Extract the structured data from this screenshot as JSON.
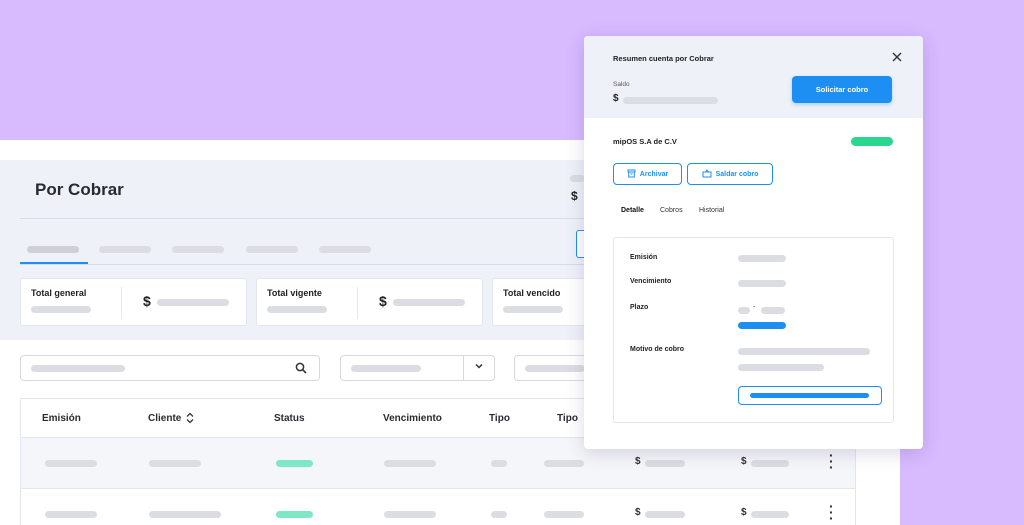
{
  "colors": {
    "accent": "#1e8ff2",
    "background_purple": "#d7baff",
    "status_green": "#2bd68f"
  },
  "main": {
    "title": "Por Cobrar",
    "summary_cards": [
      {
        "label": "Total general",
        "currency": "$"
      },
      {
        "label": "Total vigente",
        "currency": "$"
      },
      {
        "label": "Total vencido"
      }
    ],
    "search": {
      "icon": "search-icon"
    },
    "filter_select": {
      "icon": "chevron-down-icon"
    },
    "partial_currency": "$",
    "table": {
      "columns": [
        "Emisión",
        "Cliente",
        "Status",
        "Vencimiento",
        "Tipo",
        "Tipo"
      ],
      "sort_icon": "sort-icon",
      "row_currency": "$",
      "kebab_icon": "more-vertical-icon"
    }
  },
  "drawer": {
    "title": "Resumen cuenta por Cobrar",
    "close_icon": "close-icon",
    "saldo_label": "Saldo",
    "saldo_currency": "$",
    "request_button": "Solicitar cobro",
    "company": "mipOS S.A de C.V",
    "archive_button": "Archivar",
    "settle_button": "Saldar cobro",
    "tabs": [
      "Detalle",
      "Cobros",
      "Historial"
    ],
    "fields": {
      "emision": "Emisión",
      "vencimiento": "Vencimiento",
      "plazo": "Plazo",
      "plazo_separator": "-",
      "motivo": "Motivo de cobro"
    }
  }
}
